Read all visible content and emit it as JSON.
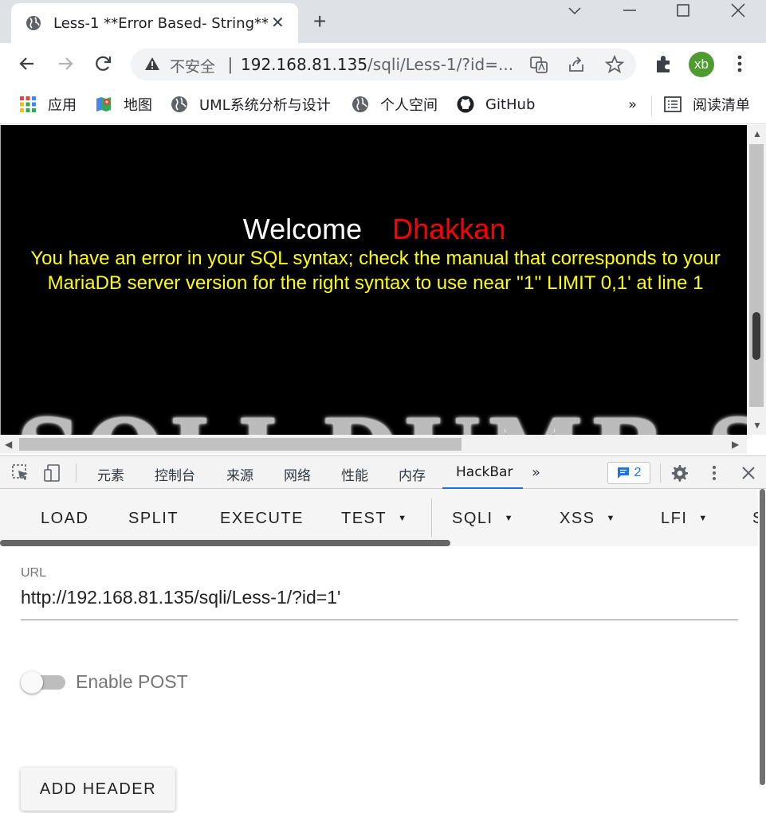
{
  "browser": {
    "tab_title": "Less-1 **Error Based- String**",
    "tab_close": "✕",
    "new_tab": "+",
    "security_label": "不安全",
    "url_host": "192.168.81.135",
    "url_path": "/sqli/Less-1/?id=...",
    "avatar_initials": "xb",
    "avatar_color": "#4e9b2f"
  },
  "bookmarks": {
    "items": [
      {
        "label": "应用",
        "icon": "apps-grid-icon"
      },
      {
        "label": "地图",
        "icon": "maps-icon"
      },
      {
        "label": "UML系统分析与设计",
        "icon": "globe-icon"
      },
      {
        "label": "个人空间",
        "icon": "globe-icon"
      },
      {
        "label": "GitHub",
        "icon": "github-icon"
      }
    ],
    "overflow": "»",
    "reading_list": "阅读清单"
  },
  "page": {
    "welcome": "Welcome",
    "name": "Dhakkan",
    "error_message": "You have an error in your SQL syntax; check the manual that corresponds to your MariaDB server version for the right syntax to use near ''1'' LIMIT 0,1' at line 1",
    "logo_text": "SQLI DUMB S"
  },
  "devtools": {
    "tabs": [
      "元素",
      "控制台",
      "来源",
      "网络",
      "性能",
      "内存",
      "HackBar"
    ],
    "active_tab": "HackBar",
    "more": "»",
    "message_count": "2"
  },
  "hackbar": {
    "buttons": [
      "LOAD",
      "SPLIT",
      "EXECUTE",
      "TEST",
      "SQLI",
      "XSS",
      "LFI",
      "S"
    ],
    "url_label": "URL",
    "url_value": "http://192.168.81.135/sqli/Less-1/?id=1'",
    "enable_post_label": "Enable POST",
    "enable_post": false,
    "add_header_label": "ADD HEADER"
  }
}
